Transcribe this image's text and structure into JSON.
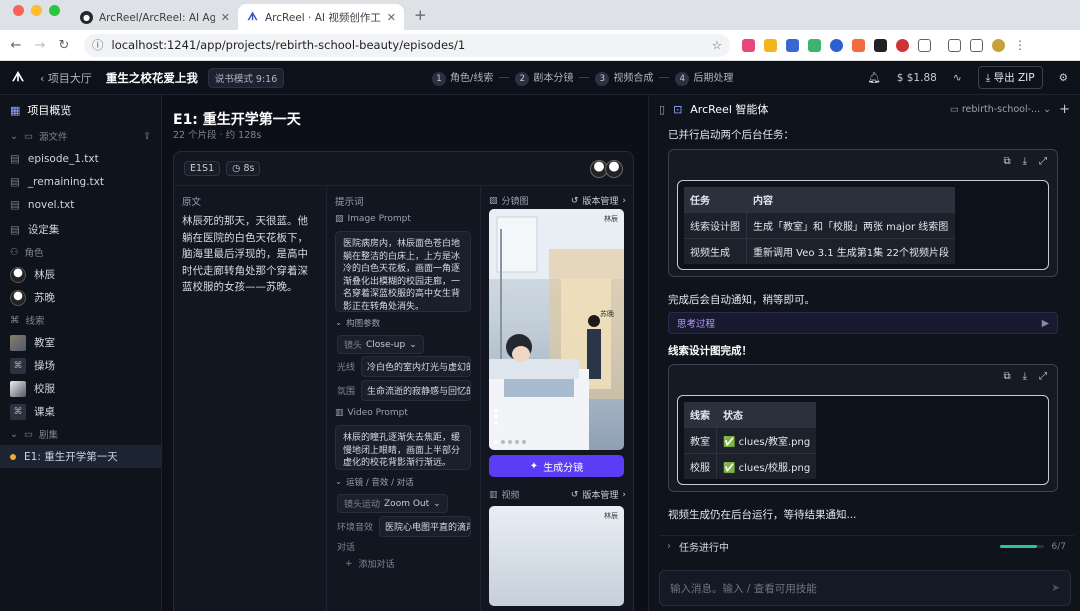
{
  "browser": {
    "tabs": [
      {
        "label": "ArcReel/ArcReel: AI Agent 驱",
        "icon": "github-icon"
      },
      {
        "label": "ArcReel · AI 视频创作工作台",
        "icon": "arcreel-icon"
      }
    ],
    "url": "localhost:1241/app/projects/rebirth-school-beauty/episodes/1"
  },
  "header": {
    "back_label": "项目大厅",
    "project_title": "重生之校花爱上我",
    "mode_badge": "说书模式 9:16",
    "steps": [
      {
        "num": "1",
        "label": "角色/线索"
      },
      {
        "num": "2",
        "label": "剧本分镜"
      },
      {
        "num": "3",
        "label": "视频合成"
      },
      {
        "num": "4",
        "label": "后期处理"
      }
    ],
    "cost": "$1.88",
    "export_label": "导出 ZIP"
  },
  "sidebar": {
    "overview": "项目概览",
    "source_section": "源文件",
    "source_files": [
      "episode_1.txt",
      "_remaining.txt",
      "novel.txt"
    ],
    "settings": "设定集",
    "roles_section": "角色",
    "roles": [
      "林辰",
      "苏晚"
    ],
    "clues_section": "线索",
    "clues": [
      "教室",
      "操场",
      "校服",
      "课桌"
    ],
    "episodes_section": "剧集",
    "episodes": [
      "E1: 重生开学第一天"
    ]
  },
  "main": {
    "episode_title": "E1: 重生开学第一天",
    "episode_sub": "22 个片段 · 约 128s",
    "segment_id": "E1S1",
    "duration": "8s",
    "original_label": "原文",
    "original_text": "林辰死的那天，天很蓝。他躺在医院的白色天花板下，脑海里最后浮现的，是高中时代走廊转角处那个穿着深蓝校服的女孩——苏晚。",
    "prompt_label": "提示词",
    "image_prompt_label": "Image Prompt",
    "image_prompt": "医院病房内，林辰面色苍白地躺在整洁的白床上，上方是冰冷的白色天花板，画面一角逐渐叠化出模糊的校园走廊，一名穿着深蓝校服的高中女生背影正在转角处消失。",
    "composition_label": "构图参数",
    "shot_prefix": "镜头",
    "shot_value": "Close-up",
    "light_label": "光线",
    "light_value": "冷白色的室内灯光与虚幻的",
    "mood_label": "氛围",
    "mood_value": "生命流逝的寂静感与回忆的",
    "video_prompt_label": "Video Prompt",
    "video_prompt": "林辰的瞳孔逐渐失去焦距，缓慢地闭上眼睛，画面上半部分虚化的校花背影渐行渐远。",
    "motion_section": "运镜 / 音效 / 对话",
    "camera_prefix": "镜头运动",
    "camera_value": "Zoom Out",
    "ambient_label": "环境音效",
    "ambient_value": "医院心电图平直的滴声",
    "dialog_label": "对话",
    "add_dialog": "添加对话",
    "storyboard_label": "分镜图",
    "version_label": "版本管理",
    "img_tag_1": "林辰",
    "img_tag_2": "苏晚",
    "generate_label": "生成分镜",
    "video_label": "视频",
    "video_version_label": "版本管理",
    "video_tag": "林辰"
  },
  "agent": {
    "title": "ArcReel 智能体",
    "session": "rebirth-school-...",
    "msg1": "已并行启动两个后台任务：",
    "table1": {
      "headers": [
        "任务",
        "内容"
      ],
      "rows": [
        [
          "线索设计图",
          "生成「教室」和「校服」两张 major 线索图"
        ],
        [
          "视频生成",
          "重新调用 Veo 3.1 生成第1集 22个视频片段"
        ]
      ]
    },
    "msg2": "完成后会自动通知，稍等即可。",
    "thinking": "思考过程",
    "msg3": "线索设计图完成！",
    "table2": {
      "headers": [
        "线索",
        "状态"
      ],
      "rows": [
        [
          "教室",
          "✅ clues/教室.png"
        ],
        [
          "校服",
          "✅ clues/校服.png"
        ]
      ]
    },
    "msg4": "视频生成仍在后台运行，等待结果通知...",
    "task_label": "任务进行中",
    "task_count": "6/7",
    "task_progress": 0.857,
    "input_placeholder": "输入消息。输入 / 查看可用技能"
  },
  "colors": {
    "accent": "#5b3df5",
    "progress": "#2ec49a",
    "thinking": "#b59cff"
  }
}
